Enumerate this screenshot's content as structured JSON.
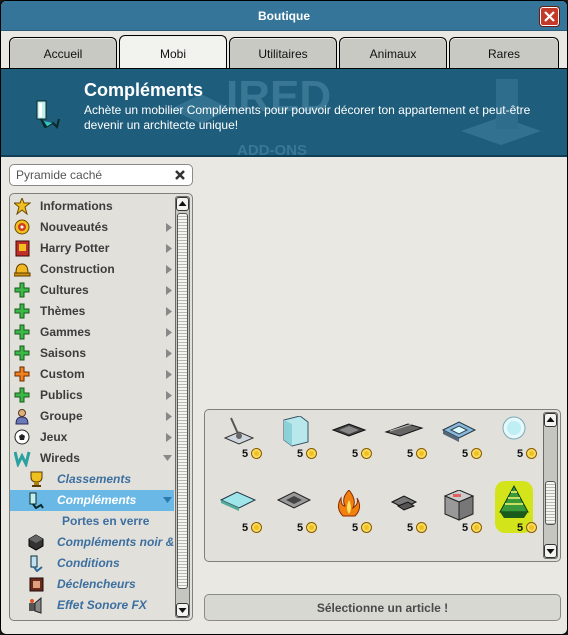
{
  "window": {
    "title": "Boutique"
  },
  "tabs": [
    {
      "label": "Accueil",
      "active": false
    },
    {
      "label": "Mobi",
      "active": true
    },
    {
      "label": "Utilitaires",
      "active": false
    },
    {
      "label": "Animaux",
      "active": false
    },
    {
      "label": "Rares",
      "active": false
    }
  ],
  "banner": {
    "title": "Compléments",
    "description": "Achète un mobilier Compléments pour pouvoir décorer ton appartement et peut-être devenir un architecte unique!",
    "background_text": "ADD-ONS"
  },
  "search": {
    "value": "Pyramide caché",
    "placeholder": ""
  },
  "categories": [
    {
      "label": "Informations",
      "icon": "star-burst-icon",
      "arrow": false
    },
    {
      "label": "Nouveautés",
      "icon": "target-badge-icon",
      "arrow": true
    },
    {
      "label": "Harry Potter",
      "icon": "red-book-icon",
      "arrow": true
    },
    {
      "label": "Construction",
      "icon": "hard-hat-icon",
      "arrow": true
    },
    {
      "label": "Cultures",
      "icon": "green-plus-icon",
      "arrow": true
    },
    {
      "label": "Thèmes",
      "icon": "green-plus-icon",
      "arrow": true
    },
    {
      "label": "Gammes",
      "icon": "green-plus-icon",
      "arrow": true
    },
    {
      "label": "Saisons",
      "icon": "green-plus-icon",
      "arrow": true
    },
    {
      "label": "Custom",
      "icon": "orange-plus-icon",
      "arrow": true
    },
    {
      "label": "Publics",
      "icon": "green-plus-icon",
      "arrow": true
    },
    {
      "label": "Groupe",
      "icon": "group-people-icon",
      "arrow": true
    },
    {
      "label": "Jeux",
      "icon": "soccer-ball-icon",
      "arrow": true
    },
    {
      "label": "Wireds",
      "icon": "wired-w-icon",
      "arrow": "down"
    }
  ],
  "wired_subcategories": [
    {
      "label": "Classements",
      "icon": "trophy-icon",
      "selected": false
    },
    {
      "label": "Compléments",
      "icon": "wired-addon-icon",
      "selected": true
    },
    {
      "label": "Portes en verre",
      "icon": "",
      "selected": false
    },
    {
      "label": "Compléments noir & b",
      "icon": "black-cube-icon",
      "selected": false
    },
    {
      "label": "Conditions",
      "icon": "condition-icon",
      "selected": false
    },
    {
      "label": "Déclencheurs",
      "icon": "trigger-icon",
      "selected": false
    },
    {
      "label": "Effet Sonore FX",
      "icon": "sound-fx-icon",
      "selected": false
    }
  ],
  "products": [
    {
      "price": "5",
      "icon": "lever-wand-icon"
    },
    {
      "price": "5",
      "icon": "glass-panel-icon"
    },
    {
      "price": "5",
      "icon": "dark-tile-icon"
    },
    {
      "price": "5",
      "icon": "rail-tile-icon"
    },
    {
      "price": "5",
      "icon": "blue-pad-icon"
    },
    {
      "price": "5",
      "icon": "light-orb-icon"
    },
    {
      "price": "5",
      "icon": "cyan-tile-icon"
    },
    {
      "price": "5",
      "icon": "square-pad-icon"
    },
    {
      "price": "5",
      "icon": "fire-icon"
    },
    {
      "price": "5",
      "icon": "cross-tile-icon"
    },
    {
      "price": "5",
      "icon": "grey-box-icon"
    },
    {
      "price": "5",
      "icon": "green-pyramid-icon",
      "highlight": true
    }
  ],
  "footer": {
    "select_label": "Sélectionne un article !"
  },
  "colors": {
    "titlebar": "#35759a",
    "banner": "#1e5d7c",
    "selection": "#6ab8e6",
    "highlight": "#d4e41a"
  }
}
